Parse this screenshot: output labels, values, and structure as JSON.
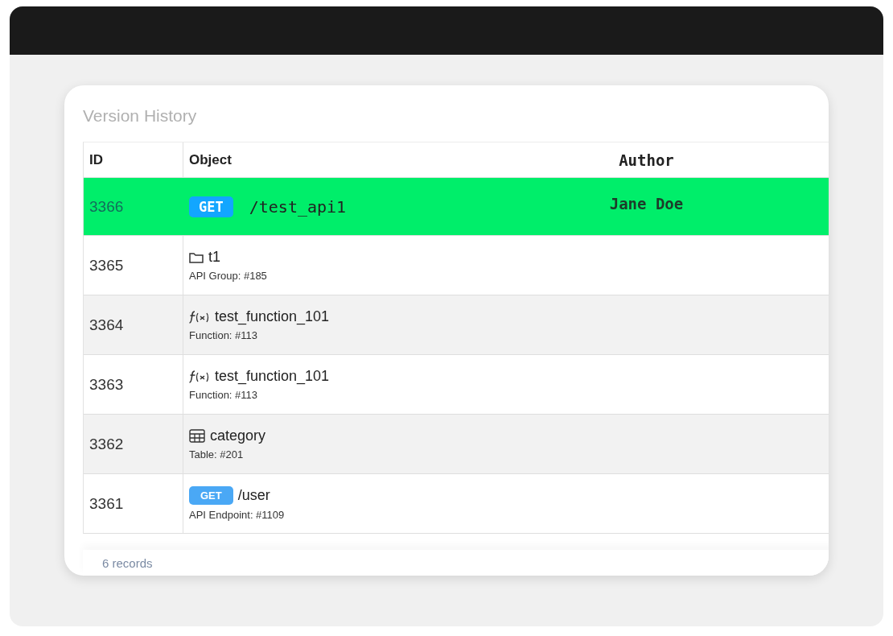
{
  "panel": {
    "title": "Version History"
  },
  "table": {
    "columns": [
      "ID",
      "Object",
      "Author"
    ],
    "rows": [
      {
        "id": "3366",
        "kind": "endpoint",
        "method": "GET",
        "name": "/test_api1",
        "author": "Jane Doe",
        "selected": true
      },
      {
        "id": "3365",
        "kind": "group",
        "name": "t1",
        "subtitle": "API Group: #185",
        "selected": false
      },
      {
        "id": "3364",
        "kind": "function",
        "name": "test_function_101",
        "subtitle": "Function: #113",
        "selected": false
      },
      {
        "id": "3363",
        "kind": "function",
        "name": "test_function_101",
        "subtitle": "Function: #113",
        "selected": false
      },
      {
        "id": "3362",
        "kind": "table",
        "name": "category",
        "subtitle": "Table: #201",
        "selected": false
      },
      {
        "id": "3361",
        "kind": "endpoint",
        "method": "GET",
        "name": "/user",
        "subtitle": "API Endpoint: #1109",
        "selected": false
      }
    ]
  },
  "footer": {
    "count": "6 records"
  }
}
